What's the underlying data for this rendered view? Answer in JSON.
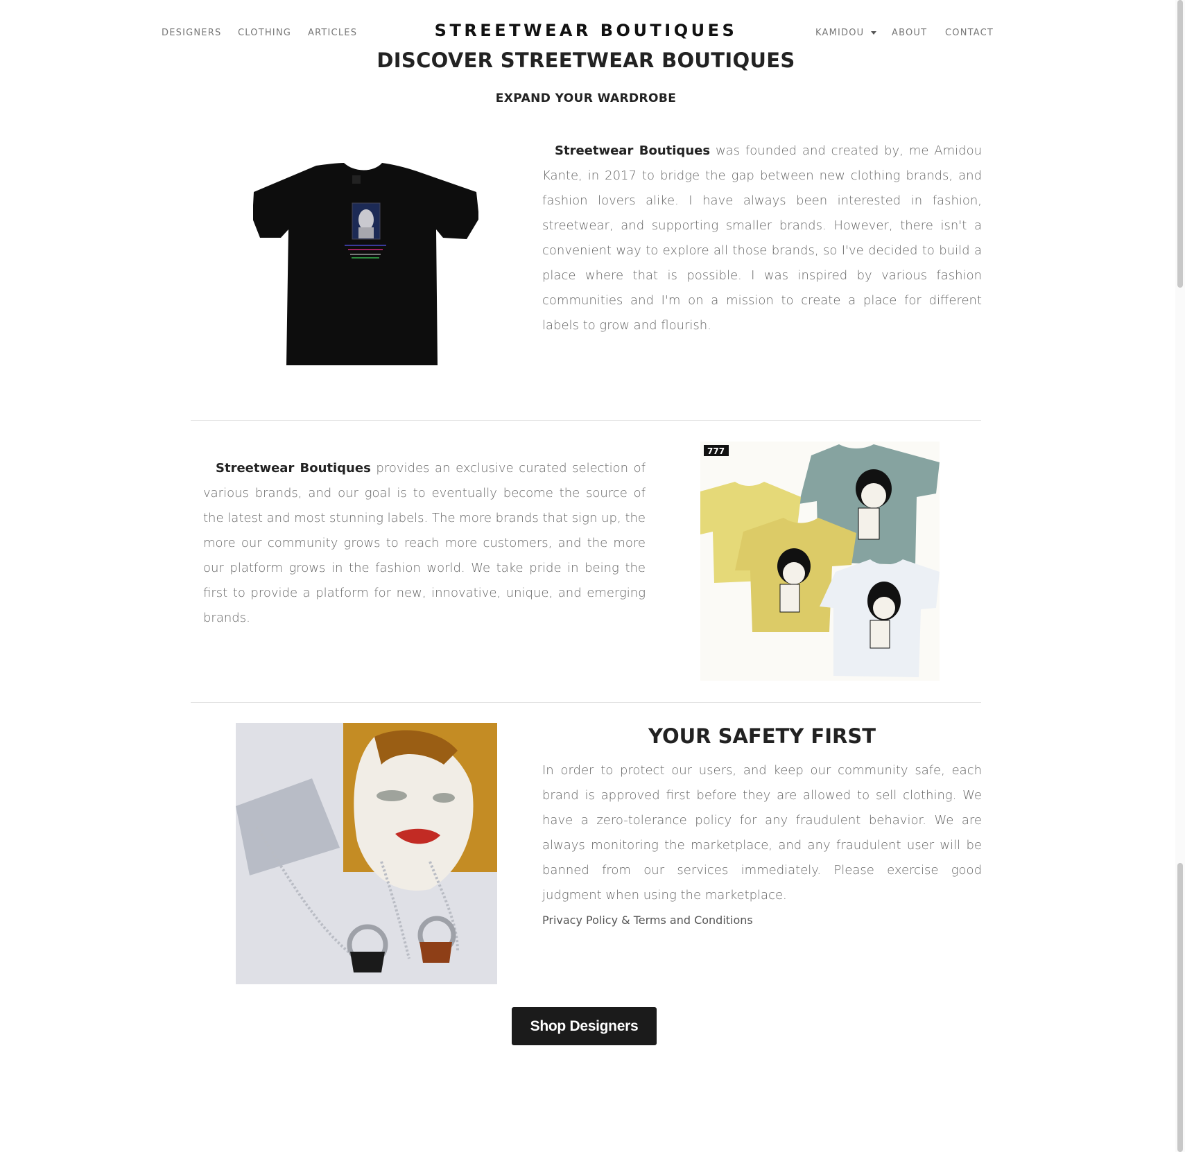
{
  "nav": {
    "left_links": [
      "DESIGNERS",
      "CLOTHING",
      "ARTICLES"
    ],
    "brand": "STREETWEAR BOUTIQUES",
    "user_menu": "KAMIDOU",
    "right_links": [
      "ABOUT",
      "CONTACT"
    ]
  },
  "header": {
    "title": "DISCOVER STREETWEAR BOUTIQUES",
    "subtitle": "EXPAND YOUR WARDROBE"
  },
  "section1": {
    "brand_bold": "Streetwear Boutiques",
    "text": " was founded and created by, me Amidou Kante, in 2017 to bridge the gap between new clothing brands, and fashion lovers alike. I have always been interested in fashion, streetwear, and supporting smaller brands. However, there isn't a convenient way to explore all those brands, so I've decided to build a place where that is possible. I was inspired by various fashion communities and I'm on a mission to create a place for different labels to grow and flourish."
  },
  "section2": {
    "brand_bold": "Streetwear Boutiques",
    "text": " provides an exclusive curated selection of various brands, and our goal is to eventually become the source of the latest and most stunning labels. The more brands that sign up, the more our community grows to reach more customers, and the more our platform grows in the fashion world. We take pride in being the first to provide a platform for new, innovative, unique, and emerging brands.",
    "image_tag": "777"
  },
  "section3": {
    "title": "YOUR SAFETY FIRST",
    "text": "In order to protect our users, and keep our community safe, each brand is approved first before they are allowed to sell clothing. We have a zero-tolerance policy for any fraudulent behavior. We are always monitoring the marketplace, and any fraudulent user will be banned from our services immediately. Please exercise good judgment when using the marketplace.",
    "policy_link": "Privacy Policy & Terms and Conditions"
  },
  "cta": {
    "label": "Shop Designers"
  },
  "colors": {
    "button": "#1b1b1b",
    "text": "#666666",
    "heading": "#222222"
  }
}
